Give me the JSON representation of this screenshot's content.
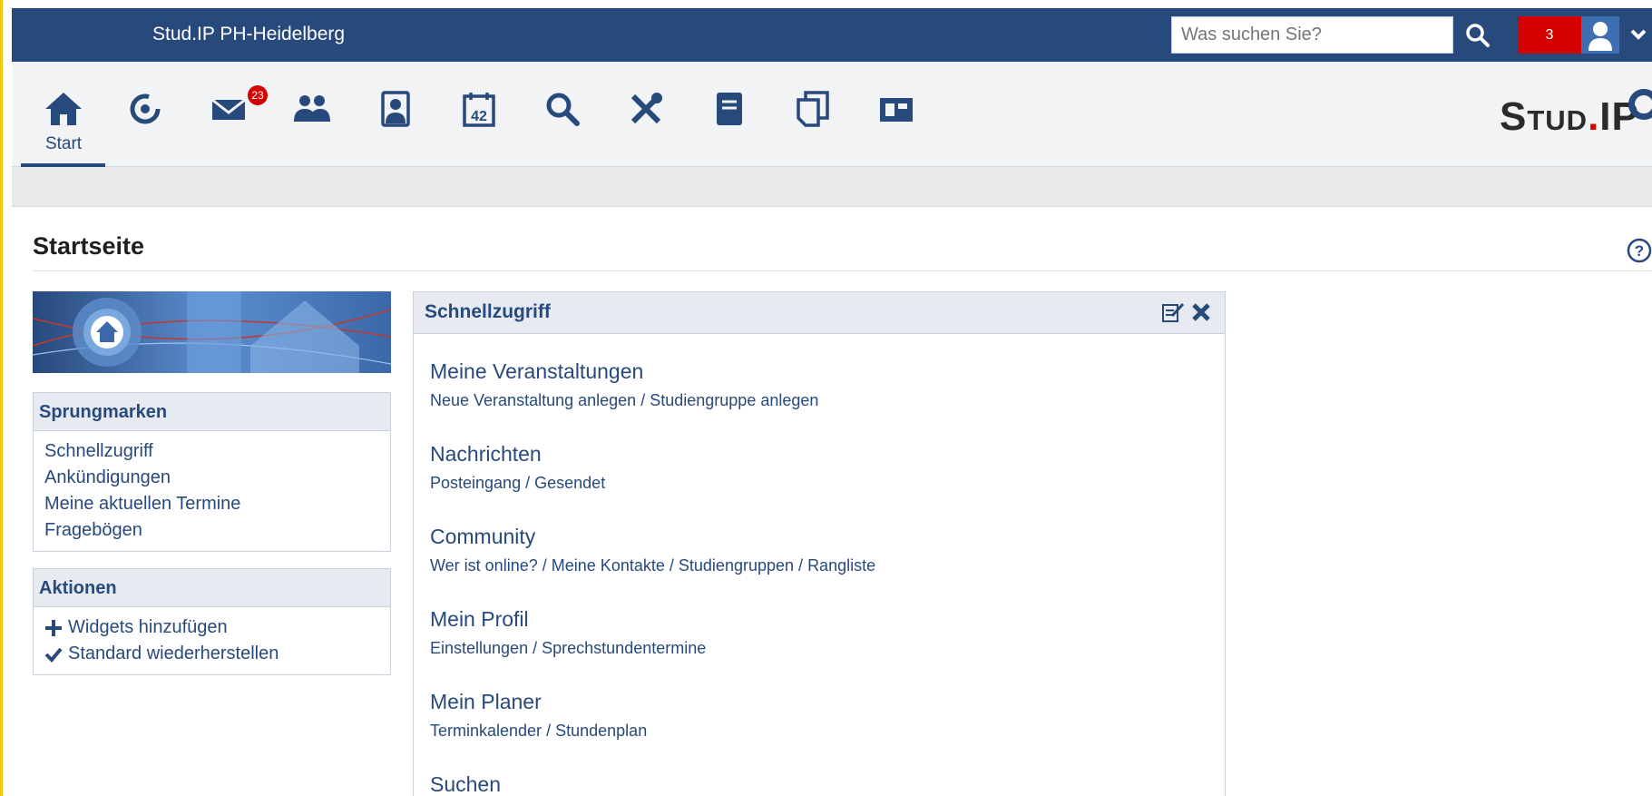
{
  "header": {
    "site_title": "Stud.IP PH-Heidelberg",
    "search_placeholder": "Was suchen Sie?",
    "notification_count": "3"
  },
  "nav": {
    "items": [
      {
        "icon": "home-icon",
        "label": "Start",
        "active": true
      },
      {
        "icon": "activity-icon"
      },
      {
        "icon": "mail-icon",
        "badge": "23"
      },
      {
        "icon": "community-icon"
      },
      {
        "icon": "profile-icon"
      },
      {
        "icon": "calendar-icon",
        "text": "42"
      },
      {
        "icon": "search-icon"
      },
      {
        "icon": "tools-icon"
      },
      {
        "icon": "notes-icon"
      },
      {
        "icon": "files-icon"
      },
      {
        "icon": "plugins-icon"
      }
    ],
    "logo_main": "Stud",
    "logo_dot": ".",
    "logo_end": "IP"
  },
  "page": {
    "title": "Startseite"
  },
  "sidebar": {
    "jumpmarks": {
      "title": "Sprungmarken",
      "items": [
        "Schnellzugriff",
        "Ankündigungen",
        "Meine aktuellen Termine",
        "Fragebögen"
      ]
    },
    "actions": {
      "title": "Aktionen",
      "items": [
        "Widgets hinzufügen",
        "Standard wiederherstellen"
      ]
    }
  },
  "quickaccess": {
    "title": "Schnellzugriff",
    "sections": [
      {
        "title": "Meine Veranstaltungen",
        "links": [
          "Neue Veranstaltung anlegen",
          "Studiengruppe anlegen"
        ]
      },
      {
        "title": "Nachrichten",
        "links": [
          "Posteingang",
          "Gesendet"
        ]
      },
      {
        "title": "Community",
        "links": [
          "Wer ist online?",
          "Meine Kontakte",
          "Studiengruppen",
          "Rangliste"
        ]
      },
      {
        "title": "Mein Profil",
        "links": [
          "Einstellungen",
          "Sprechstundentermine"
        ]
      },
      {
        "title": "Mein Planer",
        "links": [
          "Terminkalender",
          "Stundenplan"
        ]
      },
      {
        "title": "Suchen",
        "links": []
      }
    ],
    "link_separator": "/"
  },
  "colors": {
    "brand": "#28497c",
    "alert": "#d60000",
    "frame": "#f2c90c"
  }
}
